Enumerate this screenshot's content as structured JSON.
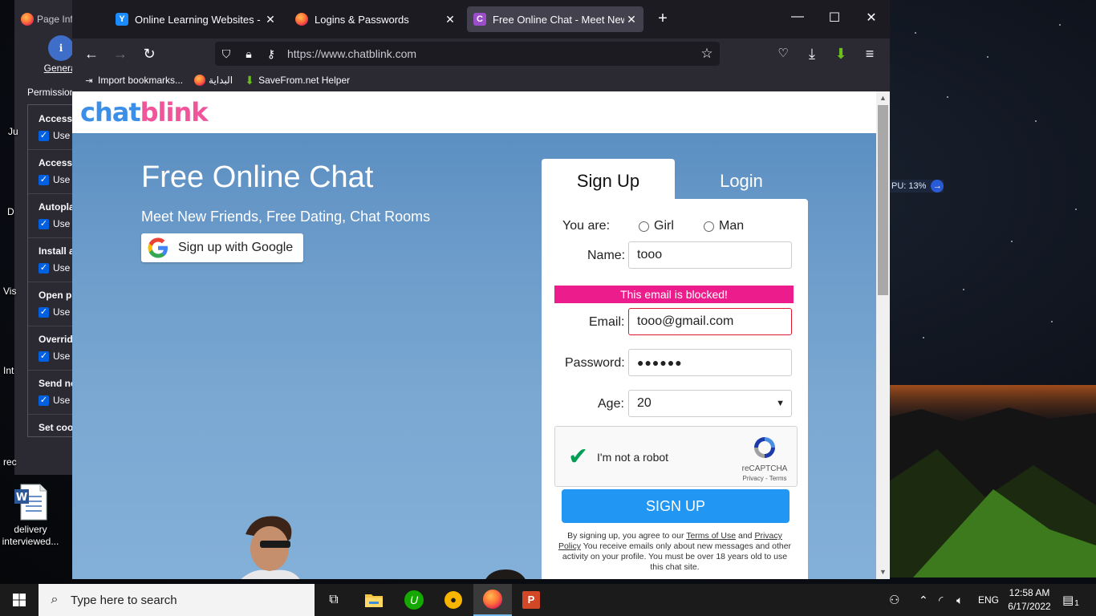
{
  "colors": {
    "accent_blue": "#2196f3",
    "brand_blue": "#3b8fe8",
    "brand_pink": "#f0559b",
    "error_pink": "#ec1c8c",
    "browser_dark": "#1c1b22"
  },
  "background_window": {
    "tab_label": "Page Inf",
    "general_label": "General",
    "permissions_label": "Permission",
    "items": [
      {
        "title": "Access",
        "use": "Use"
      },
      {
        "title": "Access",
        "use": "Use"
      },
      {
        "title": "Autopla",
        "use": "Use"
      },
      {
        "title": "Install a",
        "use": "Use"
      },
      {
        "title": "Open p",
        "use": "Use"
      },
      {
        "title": "Overrid",
        "use": "Use"
      },
      {
        "title": "Send no",
        "use": "Use"
      }
    ],
    "last_item": "Set coo"
  },
  "desktop": {
    "icon_fragments": [
      "Ju",
      "D",
      "Vis",
      "Int",
      "rec"
    ],
    "word_file_label": "delivery interviewed..."
  },
  "browser": {
    "tabs": [
      {
        "title": "Online Learning Websites - Visy",
        "icon": "y-icon",
        "active": false
      },
      {
        "title": "Logins & Passwords",
        "icon": "firefox-icon",
        "active": false
      },
      {
        "title": "Free Online Chat - Meet New Fr",
        "icon": "c-icon",
        "active": true
      }
    ],
    "url": "https://www.chatblink.com",
    "bookmarks": [
      {
        "label": "Import bookmarks...",
        "icon": "import-icon"
      },
      {
        "label": "البداية",
        "icon": "firefox-icon"
      },
      {
        "label": "SaveFrom.net Helper",
        "icon": "download-arrow-icon"
      }
    ]
  },
  "page": {
    "logo_part1": "chat",
    "logo_part2": "blink",
    "hero_title": "Free Online Chat",
    "hero_subtitle": "Meet New Friends, Free Dating, Chat Rooms",
    "google_button": "Sign up with Google",
    "tab_signup": "Sign Up",
    "tab_login": "Login",
    "form": {
      "you_are_label": "You are:",
      "option_girl": "Girl",
      "option_man": "Man",
      "name_label": "Name:",
      "name_value": "tooo",
      "error_message": "This email is blocked!",
      "email_label": "Email:",
      "email_value": "tooo@gmail.com",
      "password_label": "Password:",
      "password_value": "●●●●●●",
      "age_label": "Age:",
      "age_value": "20",
      "captcha_text": "I'm not a robot",
      "captcha_brand": "reCAPTCHA",
      "captcha_links": "Privacy - Terms",
      "submit_label": "SIGN UP",
      "terms_prefix": "By signing up, you agree to our",
      "terms_link": "Terms of Use",
      "terms_and": "and",
      "privacy_link": "Privacy Policy",
      "terms_rest": "You receive emails only about new messages and other activity on your profile. You must be over 18 years old to use this chat site."
    }
  },
  "cpu_widget": "PU: 13%",
  "taskbar": {
    "search_placeholder": "Type here to search",
    "language": "ENG",
    "time": "12:58 AM",
    "date": "6/17/2022",
    "notification_count": "1"
  }
}
